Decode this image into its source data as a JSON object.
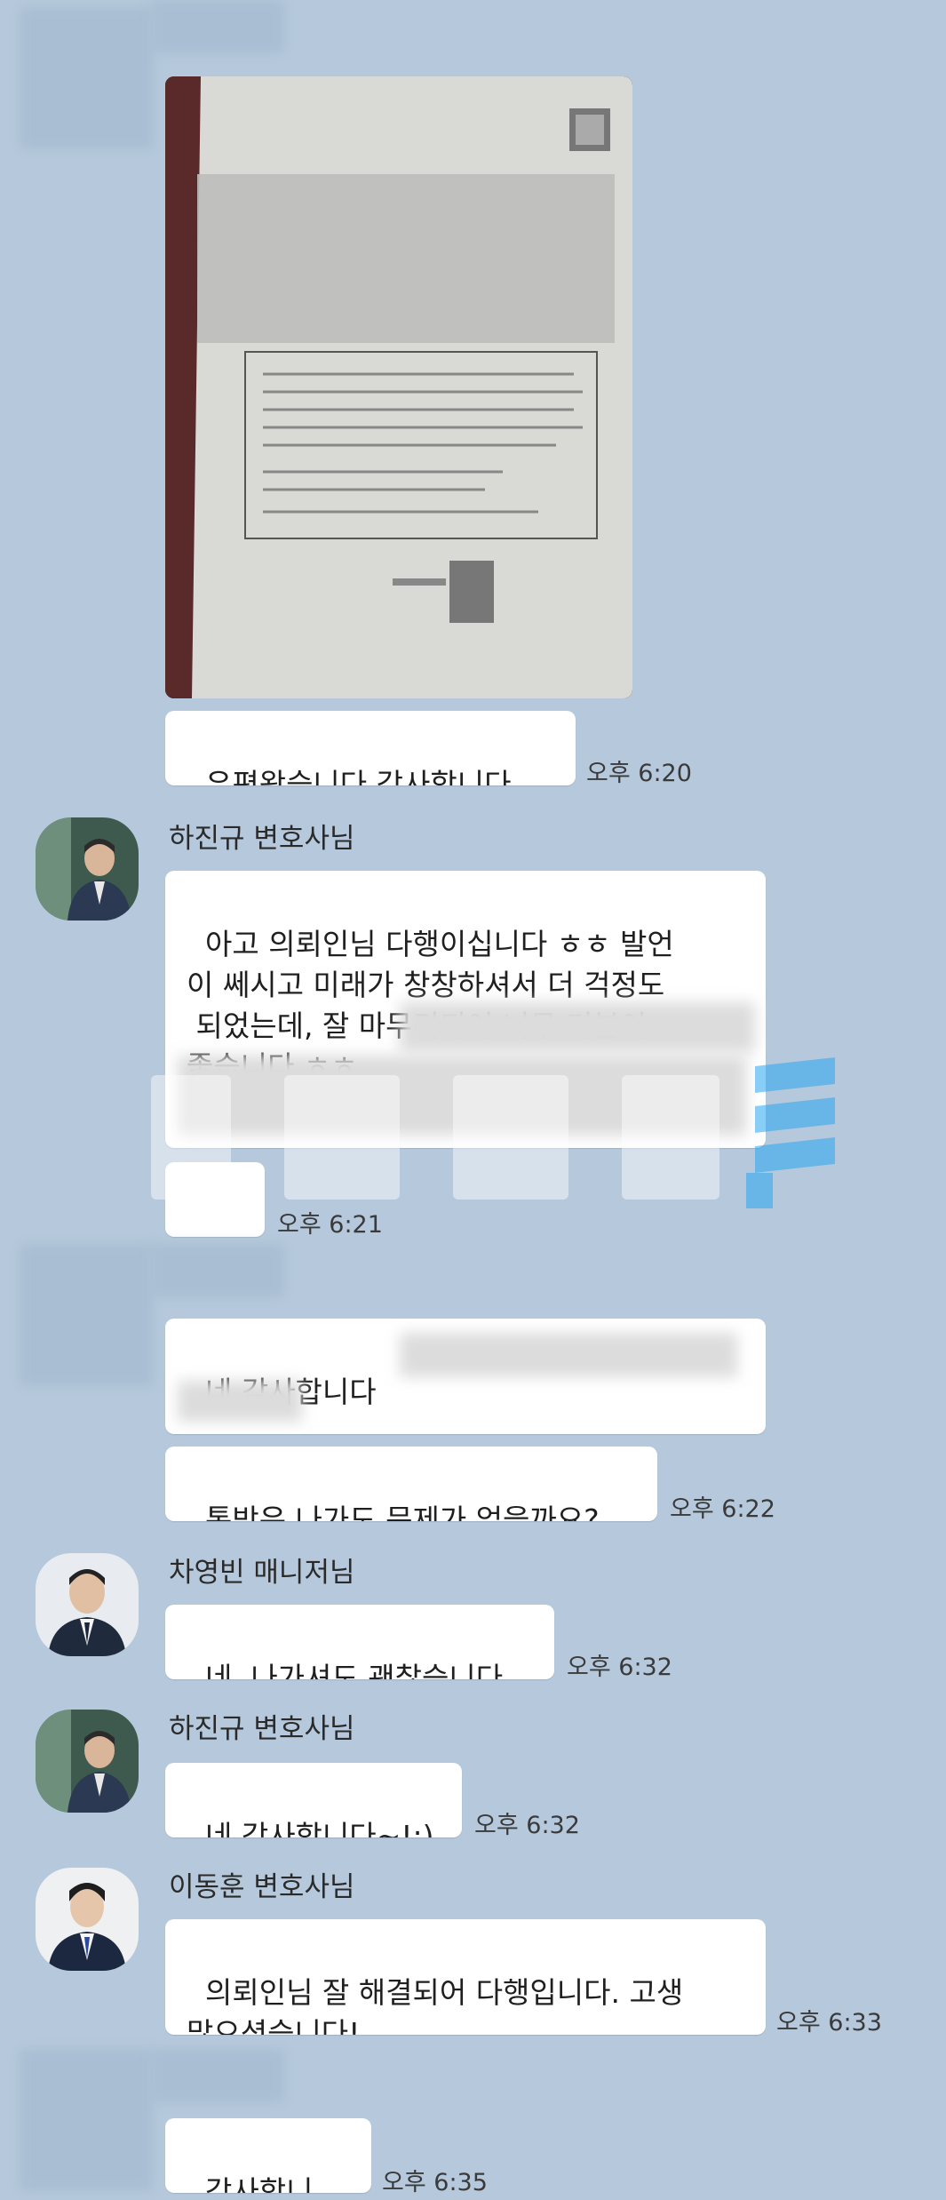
{
  "messages": {
    "m1": {
      "text": "우편왔습니다 감사합니다.",
      "time": "오후 6:20"
    },
    "m2": {
      "sender": "하진규 변호사님",
      "text": "아고 의뢰인님 다행이십니다 ㅎㅎ 발언\n이 쎄시고 미래가 창창하셔서 더 걱정도\n 되었는데, 잘 마무리되어 너무 기분이\n좋습니다 ㅎㅎ"
    },
    "m3": {
      "text": "~!:)",
      "time": "오후 6:21"
    },
    "m4": {
      "text": "네 감사합니다"
    },
    "m5": {
      "text": "톡방은 나가도 문제가 없을까요?",
      "time": "오후 6:22"
    },
    "m6": {
      "sender": "차영빈 매니저님",
      "text": "네  나가셔도 괜찮습니다.",
      "time": "오후 6:32"
    },
    "m7": {
      "sender": "하진규 변호사님",
      "text": "네 감사합니다~!:)",
      "time": "오후 6:32"
    },
    "m8": {
      "sender": "이동훈 변호사님",
      "text": "의뢰인님 잘 해결되어 다행입니다. 고생\n많으셨습니다!",
      "time": "오후 6:33"
    },
    "m9": {
      "text": "감사합니다!",
      "time": "오후 6:35"
    }
  },
  "colors": {
    "background": "#b6c9dc",
    "bubble": "#ffffff",
    "watermark": "#2aa7f0"
  },
  "icons": {
    "photo": "document-photo",
    "avatar": "profile-photo"
  }
}
